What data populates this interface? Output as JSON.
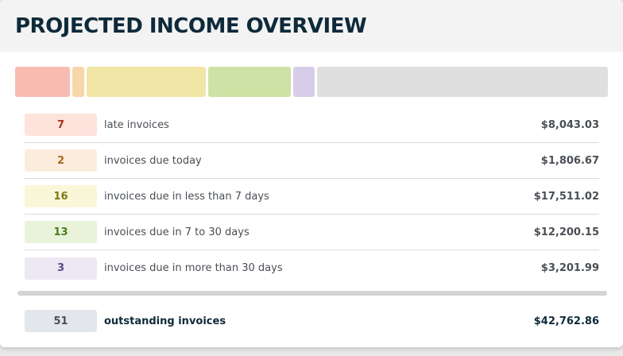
{
  "header": {
    "title": "PROJECTED INCOME OVERVIEW"
  },
  "bar": {
    "segments": [
      {
        "name": "late",
        "value": 8043.03,
        "color": "#f8bdb0"
      },
      {
        "name": "due-today",
        "value": 1806.67,
        "color": "#f8d6a8"
      },
      {
        "name": "less-than-7",
        "value": 17511.02,
        "color": "#f1e6a6"
      },
      {
        "name": "7-to-30",
        "value": 12200.15,
        "color": "#cde3a5"
      },
      {
        "name": "more-than-30",
        "value": 3201.99,
        "color": "#d8cde9"
      },
      {
        "name": "remaining",
        "value": 42762.86,
        "color": "#dfdfdf"
      }
    ]
  },
  "rows": [
    {
      "count": "7",
      "label": "late invoices",
      "amount": "$8,043.03",
      "badge_bg": "#fde3dc",
      "badge_fg": "#a8321f"
    },
    {
      "count": "2",
      "label": "invoices due today",
      "amount": "$1,806.67",
      "badge_bg": "#fcecdb",
      "badge_fg": "#a66a1e"
    },
    {
      "count": "16",
      "label": "invoices due in less than 7 days",
      "amount": "$17,511.02",
      "badge_bg": "#faf6d8",
      "badge_fg": "#7a7a1a"
    },
    {
      "count": "13",
      "label": "invoices due in 7 to 30 days",
      "amount": "$12,200.15",
      "badge_bg": "#e9f3da",
      "badge_fg": "#4a7a1e"
    },
    {
      "count": "3",
      "label": "invoices due in more than 30 days",
      "amount": "$3,201.99",
      "badge_bg": "#ece8f4",
      "badge_fg": "#5b4a8a"
    }
  ],
  "total": {
    "count": "51",
    "label": "outstanding invoices",
    "amount": "$42,762.86"
  }
}
